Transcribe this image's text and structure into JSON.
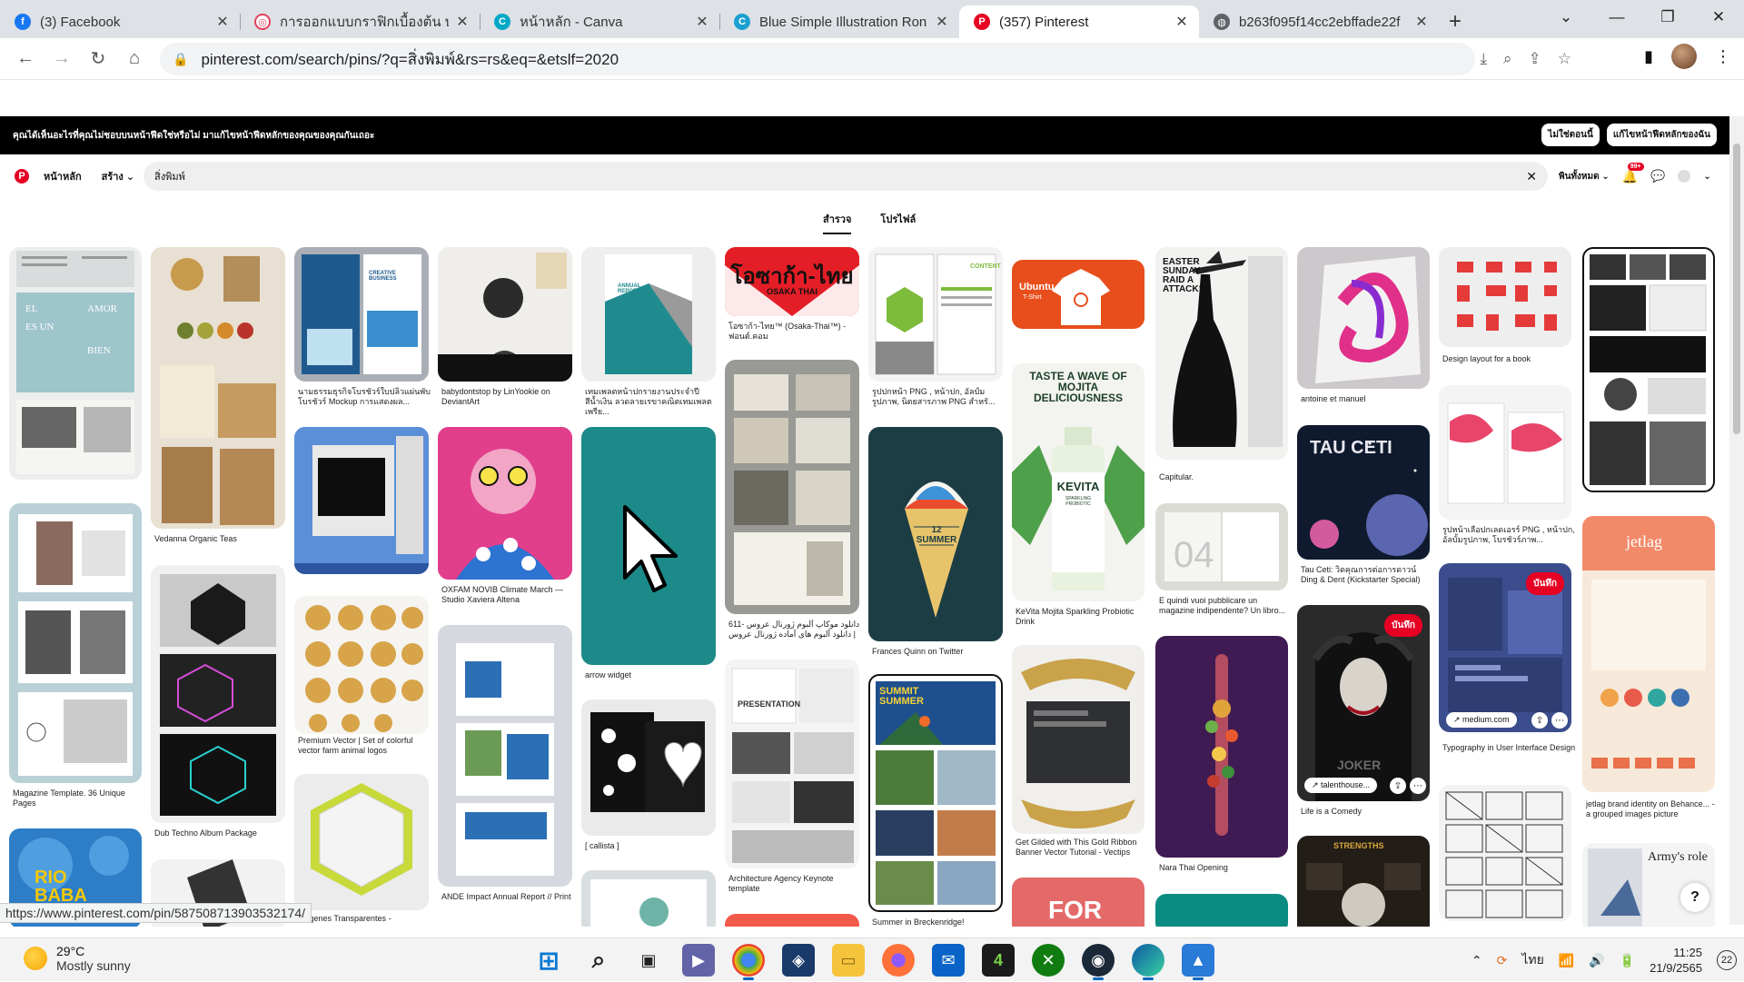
{
  "browser": {
    "tabs": [
      {
        "title": "(3) Facebook",
        "color": "#1877f2",
        "glyph": "f"
      },
      {
        "title": "การออกแบบกราฟิกเบื้องต้น บทที่",
        "color": "#e4405f",
        "glyph": "◎"
      },
      {
        "title": "หน้าหลัก - Canva",
        "color": "#00c4cc",
        "glyph": "C"
      },
      {
        "title": "Blue Simple Illustration Ron",
        "color": "#7d2ae8",
        "glyph": "C"
      },
      {
        "title": "(357) Pinterest",
        "color": "#e60023",
        "glyph": "P"
      },
      {
        "title": "b263f095f14cc2ebffade22f",
        "color": "#5f6368",
        "glyph": "◍"
      }
    ],
    "url": "pinterest.com/search/pins/?q=สิ่งพิมพ์&rs=rs&eq=&etslf=2020",
    "status_url": "https://www.pinterest.com/pin/587508713903532174/"
  },
  "pinterest": {
    "banner_text": "คุณได้เห็นอะไรที่คุณไม่ชอบบนหน้าฟีดใช่หรือไม่ มาแก้ไขหน้าฟีดหลักของคุณของคุณกันเถอะ",
    "banner_btn_1": "ไม่ใช่ตอนนี้",
    "banner_btn_2": "แก้ไขหน้าฟีดหลักของฉัน",
    "nav_home": "หน้าหลัก",
    "nav_create": "สร้าง",
    "search_value": "สิ่งพิมพ์",
    "filter_label": "พินทั้งหมด",
    "badge": "99+",
    "tab_explore": "สำรวจ",
    "tab_profiles": "โปรไฟล์",
    "save_label": "บันทึก",
    "medium_label": "medium.com",
    "talent_label": "talenthouse...",
    "captions": {
      "c2": "Magazine Template. 36 Unique Pages",
      "c3": "Vedanna Organic Teas",
      "c4": "Dub Techno Album Package",
      "c5": "นามธรรมธุรกิจโบรชัวร์ใบปลิวแผ่นพับโบรชัวร์ Mockup การแสดงผล...",
      "c6": "Premium Vector | Set of colorful vector farm animal logos",
      "c7": "...agenes Transparentes -",
      "c8": "babydontstop by LinYookie on DeviantArt",
      "c9": "OXFAM NOVIB Climate March — Studio Xaviera Altena",
      "c10": "ANDE Impact Annual Report // Print",
      "c11": "เทมเพลตหน้าปกรายงานประจำปี สีน้ำเงิน ลวดลายเรขาคณิตเทมเพลตเพรีย...",
      "c12": "arrow widget",
      "c13": "[ callista ]",
      "c14": "โอซาก้า-ไทย™ (Osaka-Thai™) - ฟอนต์.คอม",
      "c15": "611- دانلود موکاپ آلبوم ژورنال عروس | دانلود آلبوم های آماده ژورنال عروس",
      "c16": "Architecture Agency Keynote template",
      "c17": "รูปปกหน้า PNG , หน้าปก, อัลบั้มรูปภาพ, นิตยสารภาพ PNG สำหรั...",
      "c18": "Frances Quinn on Twitter",
      "c19": "Summer in Breckenridge!",
      "c20": "KeVita Mojita Sparkling Probiotic Drink",
      "c21": "Get Gilded with This Gold Ribbon Banner Vector Tutorial - Vectips",
      "c22": "Capitular.",
      "c23": "E quindi vuoi pubblicare un magazine indipendente? Un libro...",
      "c24": "Nara Thai Opening",
      "c25": "antoine et manuel",
      "c26": "Tau Ceti: วิดคุณการต่อการดาวน์ Ding & Dent (Kickstarter Special)",
      "c27": "Life is a Comedy",
      "c28": "Design layout for a book",
      "c29": "รูปหน้าเลื่อปกเลดเอรร์ PNG , หน้าปก, อัลบั้มรูปภาพ, โบรชัวร์ภาพ...",
      "c30": "Typography in User Interface Design",
      "c31": "jetlag brand identity on Behance... - a grouped images picture"
    },
    "pin_text": {
      "osaka": "โอซาก้า-ไทย",
      "osaka_sub": "OSAKA THAI",
      "ubuntu": "Ubuntu",
      "ubuntu_sub": "T-Shirt",
      "attack": "EASTER SUNDAY RAID A ATTACK?",
      "kevita_top": "TASTE A WAVE OF MOJITA DELICIOUSNESS",
      "kevita": "KEVITA",
      "kevita_sub": "SPARKLING PROBIOTIC",
      "taucet": "TAU CETI",
      "jetlag": "jetlag",
      "summit": "SUMMIT SUMMER",
      "presentation": "PRESENTATION",
      "content": "CONTENT",
      "rio": "RIO BABA",
      "strengths": "STRENGTHS",
      "army": "Army's role",
      "joker": "JOKER",
      "annual": "ANNUAL REPORT",
      "creative": "CREATIVE BUSINESS",
      "magazine_words": [
        "EL",
        "AMOR",
        "ES UN",
        "BIEN"
      ],
      "cone_text": "12 SUMMER"
    }
  },
  "taskbar": {
    "temp": "29°C",
    "weather": "Mostly sunny",
    "time": "11:25",
    "date": "21/9/2565",
    "lang": "ไทย",
    "notif_count": "22"
  }
}
